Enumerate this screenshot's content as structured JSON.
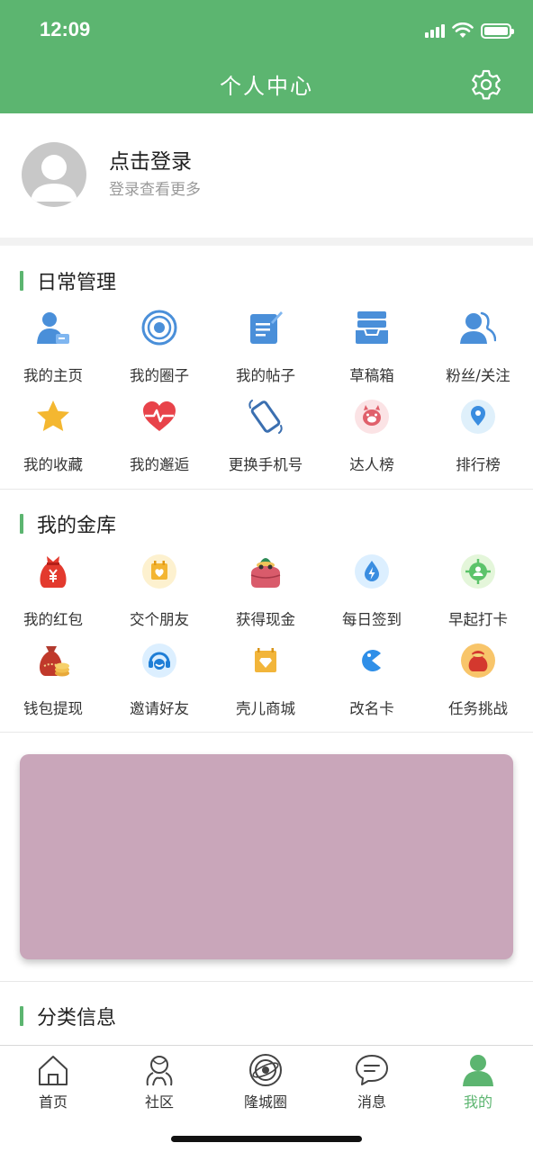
{
  "status_bar": {
    "time": "12:09"
  },
  "header": {
    "title": "个人中心",
    "settings_icon": "gear-icon"
  },
  "profile": {
    "title": "点击登录",
    "subtitle": "登录查看更多"
  },
  "daily": {
    "title": "日常管理",
    "items": [
      {
        "label": "我的主页",
        "icon": "user-card-icon"
      },
      {
        "label": "我的圈子",
        "icon": "circle-target-icon"
      },
      {
        "label": "我的帖子",
        "icon": "edit-post-icon"
      },
      {
        "label": "草稿箱",
        "icon": "inbox-drafts-icon"
      },
      {
        "label": "粉丝/关注",
        "icon": "followers-icon"
      },
      {
        "label": "我的收藏",
        "icon": "star-icon"
      },
      {
        "label": "我的邂逅",
        "icon": "heartbeat-icon"
      },
      {
        "label": "更换手机号",
        "icon": "phone-ring-icon"
      },
      {
        "label": "达人榜",
        "icon": "pig-badge-icon"
      },
      {
        "label": "排行榜",
        "icon": "location-pin-icon"
      }
    ]
  },
  "vault": {
    "title": "我的金库",
    "items": [
      {
        "label": "我的红包",
        "icon": "red-envelope-bag-icon"
      },
      {
        "label": "交个朋友",
        "icon": "calendar-heart-icon"
      },
      {
        "label": "获得现金",
        "icon": "purse-icon"
      },
      {
        "label": "每日签到",
        "icon": "lightning-drop-icon"
      },
      {
        "label": "早起打卡",
        "icon": "target-person-icon"
      },
      {
        "label": "钱包提现",
        "icon": "money-bag-coins-icon"
      },
      {
        "label": "邀请好友",
        "icon": "headset-icon"
      },
      {
        "label": "壳儿商城",
        "icon": "shop-diamond-icon"
      },
      {
        "label": "改名卡",
        "icon": "pacman-icon"
      },
      {
        "label": "任务挑战",
        "icon": "treasure-bag-icon"
      }
    ]
  },
  "category": {
    "title": "分类信息"
  },
  "tabbar": {
    "items": [
      {
        "label": "首页",
        "icon": "home-icon"
      },
      {
        "label": "社区",
        "icon": "community-icon"
      },
      {
        "label": "隆城圈",
        "icon": "planet-icon"
      },
      {
        "label": "消息",
        "icon": "message-icon"
      },
      {
        "label": "我的",
        "icon": "profile-icon",
        "active": true
      }
    ]
  },
  "colors": {
    "brand": "#5cb570",
    "banner": "#c9a6ba"
  }
}
